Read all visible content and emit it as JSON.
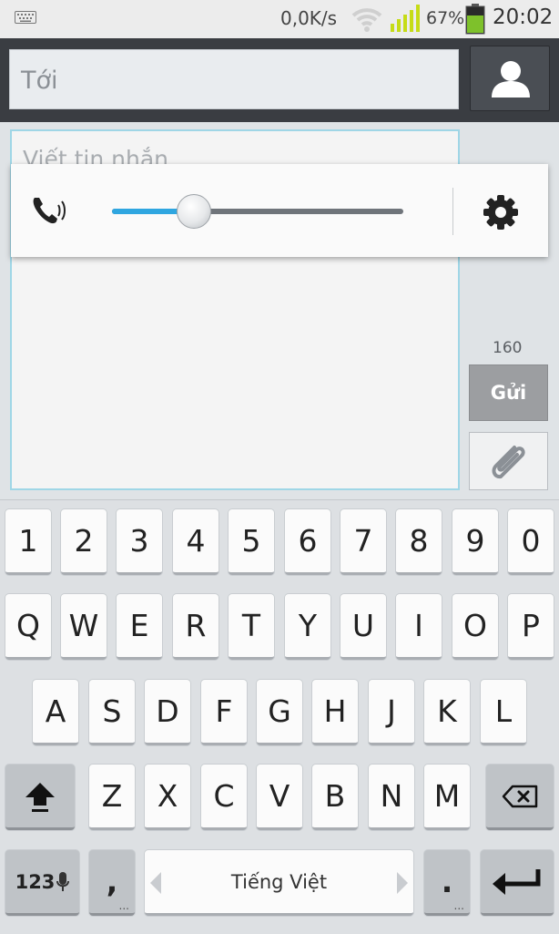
{
  "status_bar": {
    "keyboard_icon": "keyboard-icon",
    "net_speed": "0,0K/s",
    "wifi_icon": "wifi-icon",
    "signal_icon": "signal-bars-icon",
    "battery_percent": "67%",
    "battery_icon": "battery-icon",
    "battery_level": 0.67,
    "clock": "20:02",
    "signal_color": "#c6dc16",
    "battery_color": "#7ec12b"
  },
  "header": {
    "to_placeholder": "Tới",
    "contact_icon": "person-icon"
  },
  "compose": {
    "message_placeholder": "Viết tin nhắn",
    "char_count": "160",
    "send_label": "Gửi",
    "attach_icon": "paperclip-icon",
    "focus_color": "#9fd6e6"
  },
  "volume_popup": {
    "ringer_icon": "ringer-volume-icon",
    "settings_icon": "gear-icon",
    "level": 0.28,
    "accent": "#2fa6e0"
  },
  "keyboard": {
    "row_numbers": [
      "1",
      "2",
      "3",
      "4",
      "5",
      "6",
      "7",
      "8",
      "9",
      "0"
    ],
    "row_1": [
      "Q",
      "W",
      "E",
      "R",
      "T",
      "Y",
      "U",
      "I",
      "O",
      "P"
    ],
    "row_2": [
      "A",
      "S",
      "D",
      "F",
      "G",
      "H",
      "J",
      "K",
      "L"
    ],
    "row_3": [
      "Z",
      "X",
      "C",
      "V",
      "B",
      "N",
      "M"
    ],
    "shift_icon": "shift-arrow-icon",
    "backspace_icon": "backspace-icon",
    "mode_label": "123",
    "mic_icon": "microphone-icon",
    "comma": ",",
    "language": "Tiếng Việt",
    "period": ".",
    "enter_icon": "enter-arrow-icon"
  }
}
